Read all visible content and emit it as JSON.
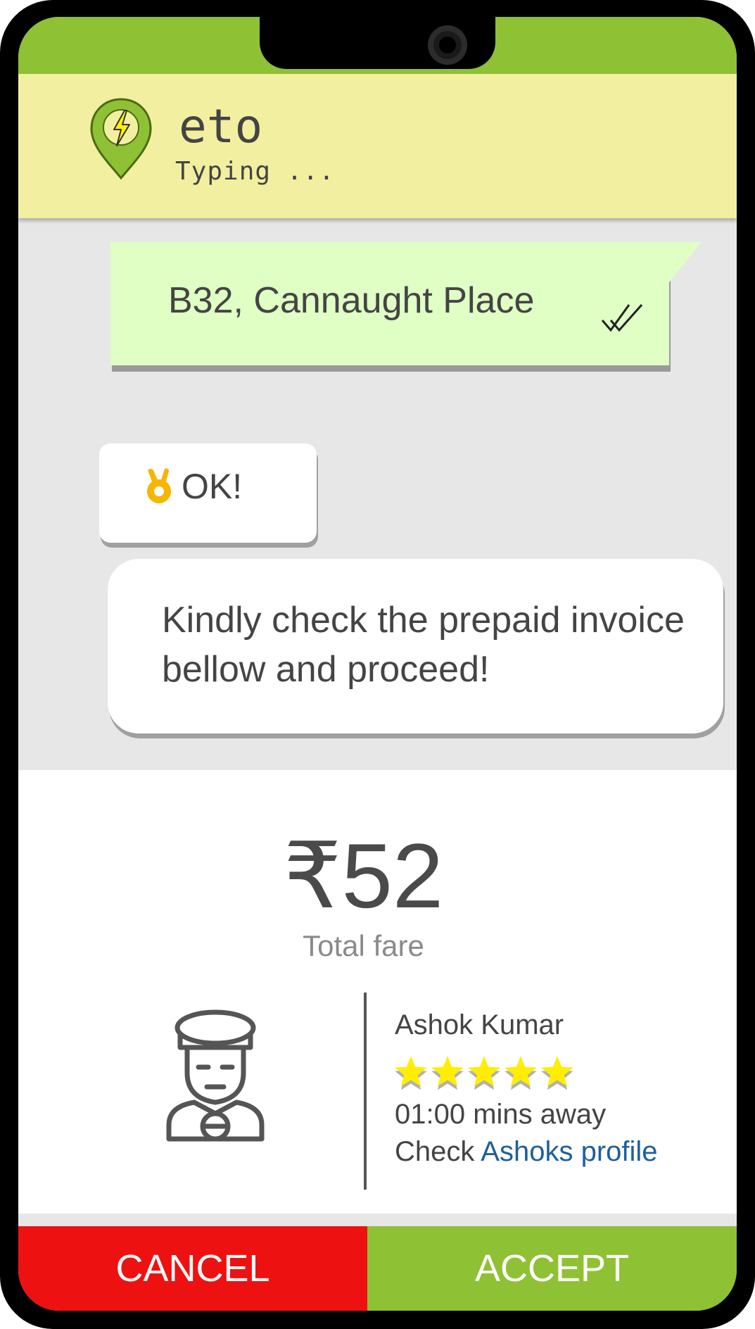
{
  "app": {
    "title": "eto",
    "status": "Typing ..."
  },
  "colors": {
    "brand_green": "#8fc134",
    "header_yellow": "#f2f0a0",
    "sent_bubble": "#dfffc4",
    "cancel_red": "#ee1111",
    "link_blue": "#1e5fa0",
    "star_yellow": "#ffee00"
  },
  "chat": {
    "sent_message": "B32, Cannaught Place",
    "reply_ok": "OK!",
    "reply_ok_icon": "ok-hand-emoji",
    "reply_message": "Kindly check the prepaid invoice bellow and proceed!"
  },
  "invoice": {
    "fare": "₹52",
    "fare_label": "Total fare",
    "driver": {
      "name": "Ashok Kumar",
      "rating": 5,
      "rating_max": 5,
      "eta": "01:00 mins away",
      "profile_prefix": "Check",
      "profile_link": "Ashoks profile"
    }
  },
  "actions": {
    "cancel_label": "CANCEL",
    "accept_label": "ACCEPT"
  }
}
